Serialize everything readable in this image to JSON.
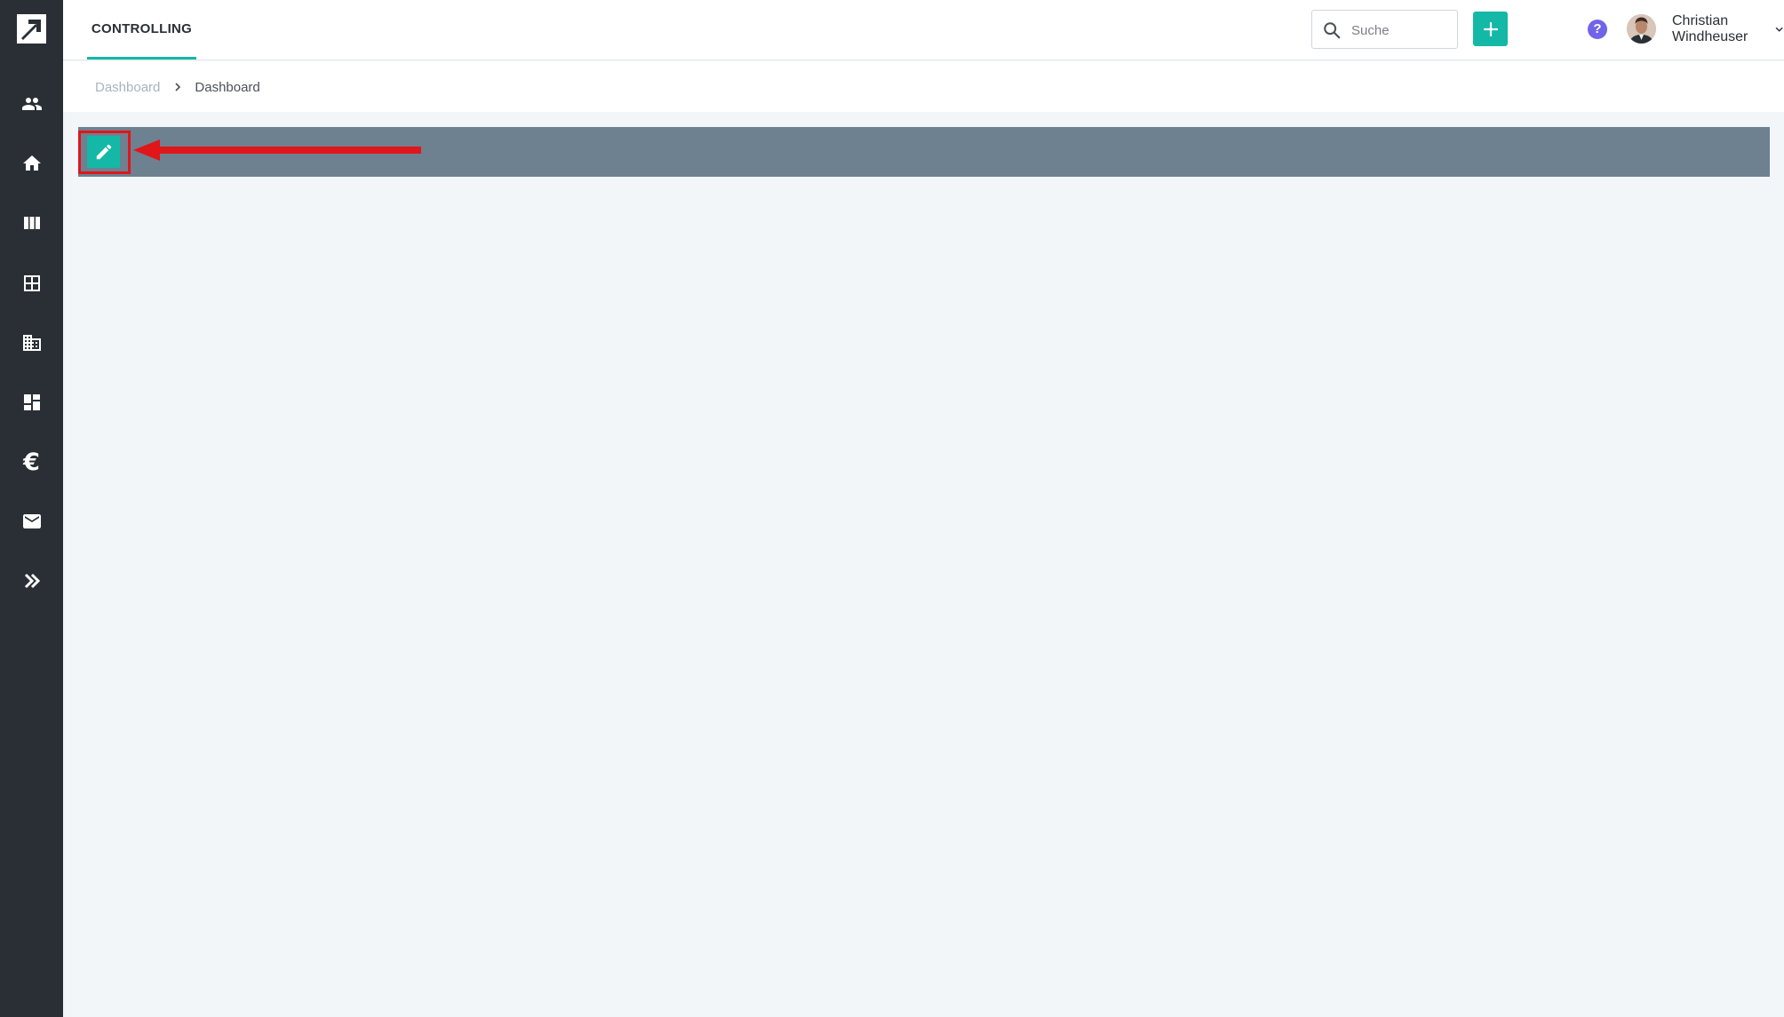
{
  "header": {
    "tab_label": "CONTROLLING",
    "search_placeholder": "Suche",
    "help_label": "?",
    "user_name": "Christian Windheuser"
  },
  "sidebar": {
    "items": [
      {
        "name": "people-icon"
      },
      {
        "name": "home-icon"
      },
      {
        "name": "columns-icon"
      },
      {
        "name": "grid-icon"
      },
      {
        "name": "building-icon"
      },
      {
        "name": "dashboard-icon"
      },
      {
        "name": "euro-icon",
        "glyph": "€"
      },
      {
        "name": "mail-icon"
      },
      {
        "name": "expand-icon"
      }
    ]
  },
  "breadcrumb": {
    "items": [
      "Dashboard",
      "Dashboard"
    ]
  },
  "colors": {
    "sidebar_bg": "#2a2f35",
    "accent": "#14b8a6",
    "bar": "#6d8190",
    "highlight": "#e0161b",
    "help": "#7264e8"
  }
}
